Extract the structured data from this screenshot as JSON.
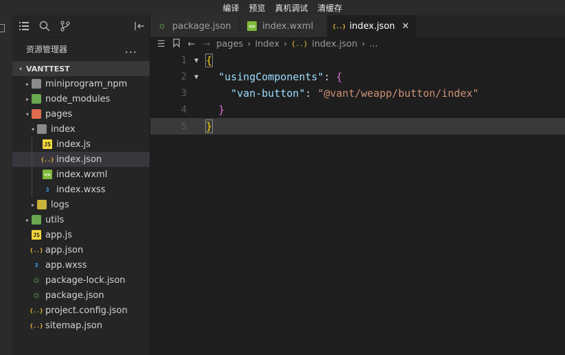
{
  "menu": [
    "编译",
    "预览",
    "真机调试",
    "清缓存"
  ],
  "explorer": {
    "title": "资源管理器",
    "more_label": "...",
    "project": "VANTTEST",
    "items": [
      {
        "label": "miniprogram_npm",
        "icon": "folder-icon",
        "indent": 0,
        "caret": "▸"
      },
      {
        "label": "node_modules",
        "icon": "folder-node-icon",
        "indent": 0,
        "caret": "▸"
      },
      {
        "label": "pages",
        "icon": "folder-pages-icon",
        "indent": 0,
        "caret": "▾"
      },
      {
        "label": "index",
        "icon": "folder-open-icon",
        "indent": 1,
        "caret": "▾"
      },
      {
        "label": "index.js",
        "icon": "js-file-icon",
        "indent": 2,
        "caret": ""
      },
      {
        "label": "index.json",
        "icon": "json-file-icon",
        "indent": 2,
        "caret": "",
        "selected": true
      },
      {
        "label": "index.wxml",
        "icon": "wxml-file-icon",
        "indent": 2,
        "caret": ""
      },
      {
        "label": "index.wxss",
        "icon": "wxss-file-icon",
        "indent": 2,
        "caret": ""
      },
      {
        "label": "logs",
        "icon": "folder-logs-icon",
        "indent": 1,
        "caret": "▸"
      },
      {
        "label": "utils",
        "icon": "folder-utils-icon",
        "indent": 0,
        "caret": "▸"
      },
      {
        "label": "app.js",
        "icon": "js-file-icon",
        "indent": 0,
        "caret": ""
      },
      {
        "label": "app.json",
        "icon": "json-file-icon",
        "indent": 0,
        "caret": ""
      },
      {
        "label": "app.wxss",
        "icon": "wxss-file-icon",
        "indent": 0,
        "caret": ""
      },
      {
        "label": "package-lock.json",
        "icon": "node-file-icon",
        "indent": 0,
        "caret": ""
      },
      {
        "label": "package.json",
        "icon": "node-file-icon",
        "indent": 0,
        "caret": ""
      },
      {
        "label": "project.config.json",
        "icon": "json-file-icon",
        "indent": 0,
        "caret": ""
      },
      {
        "label": "sitemap.json",
        "icon": "json-file-icon",
        "indent": 0,
        "caret": ""
      }
    ]
  },
  "tabs": [
    {
      "label": "package.json",
      "icon": "node-file-icon",
      "active": false
    },
    {
      "label": "index.wxml",
      "icon": "wxml-file-icon",
      "active": false
    },
    {
      "label": "index.json",
      "icon": "json-file-icon",
      "active": true,
      "close": "✕"
    }
  ],
  "breadcrumb": {
    "parts": [
      "pages",
      "index",
      "index.json",
      "..."
    ]
  },
  "code": {
    "line_numbers": [
      "1",
      "2",
      "3",
      "4",
      "5"
    ],
    "key1": "\"usingComponents\"",
    "key2": "\"van-button\"",
    "value2": "\"@vant/weapp/button/index\""
  },
  "colors": {
    "background": "#1e1e1e",
    "sidebar": "#252526",
    "selected_row": "#37373d",
    "json_icon": "#e8b93a",
    "js_icon": "#f0d53a",
    "wxss_icon": "#3aa4f0",
    "wxml_icon": "#7fb93a",
    "node_icon": "#6aa84f"
  }
}
